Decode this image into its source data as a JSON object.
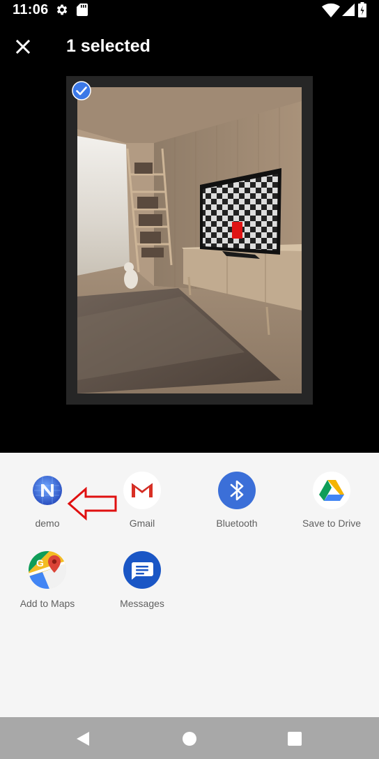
{
  "status_bar": {
    "time": "11:06",
    "icons": [
      "gear-icon",
      "sd-card-icon",
      "wifi-icon",
      "signal-icon",
      "battery-icon"
    ]
  },
  "header": {
    "close_icon": "close-icon",
    "title": "1 selected"
  },
  "preview": {
    "selected": true,
    "check_icon": "check-circle-icon"
  },
  "share_targets": [
    {
      "label": "demo",
      "icon": "nativescript-icon"
    },
    {
      "label": "Gmail",
      "icon": "gmail-icon"
    },
    {
      "label": "Bluetooth",
      "icon": "bluetooth-icon"
    },
    {
      "label": "Save to Drive",
      "icon": "drive-icon"
    },
    {
      "label": "Add to Maps",
      "icon": "maps-icon"
    },
    {
      "label": "Messages",
      "icon": "messages-icon"
    }
  ],
  "annotation": {
    "icon": "red-arrow-icon",
    "color": "#e01010"
  },
  "nav_bar": {
    "icons": [
      "back-icon",
      "home-icon",
      "recents-icon"
    ]
  },
  "colors": {
    "background": "#000000",
    "sheet": "#f5f5f5",
    "label": "#5f5f5f",
    "nav": "#a8a8a8",
    "accent_blue": "#3b78e7"
  }
}
